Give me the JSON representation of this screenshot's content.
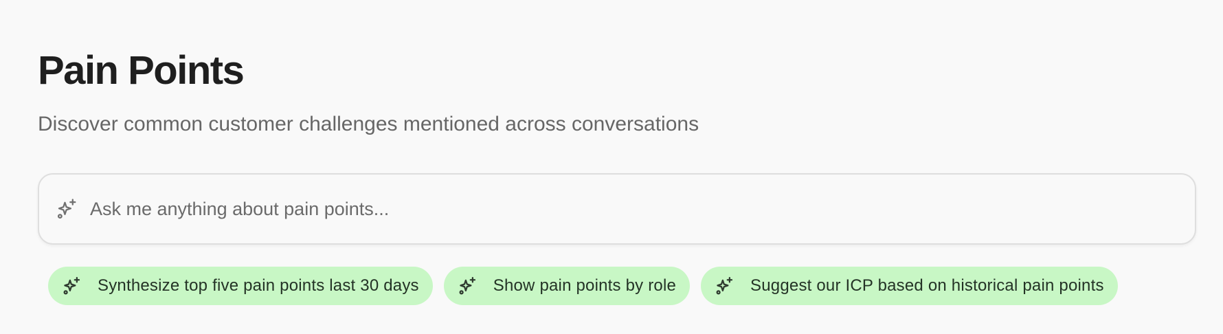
{
  "header": {
    "title": "Pain Points",
    "subtitle": "Discover common customer challenges mentioned across conversations"
  },
  "ask": {
    "icon": "sparkles-icon",
    "placeholder": "Ask me anything about pain points...",
    "value": ""
  },
  "suggestions": [
    {
      "icon": "sparkles-icon",
      "label": "Synthesize top five pain points last 30 days"
    },
    {
      "icon": "sparkles-icon",
      "label": "Show pain points by role"
    },
    {
      "icon": "sparkles-icon",
      "label": "Suggest our ICP based on historical pain points"
    }
  ],
  "colors": {
    "background": "#f9f9f9",
    "chip_background": "#c8f7c5",
    "title": "#1f1f1f",
    "subtitle": "#666666"
  }
}
